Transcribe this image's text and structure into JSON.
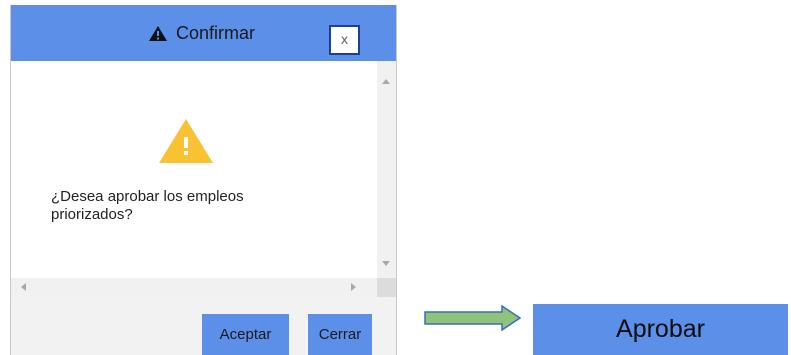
{
  "dialog": {
    "title": "Confirmar",
    "close_label": "x",
    "message": "¿Desea aprobar los empleos priorizados?",
    "buttons": {
      "accept": "Aceptar",
      "close": "Cerrar"
    }
  },
  "action_button": {
    "label": "Aprobar"
  },
  "colors": {
    "title_bar": "#5b8fe8",
    "button": "#5b8fe8",
    "warning": "#f9c233",
    "arrow_fill": "#8fc27a",
    "arrow_stroke": "#3a6fb5"
  }
}
